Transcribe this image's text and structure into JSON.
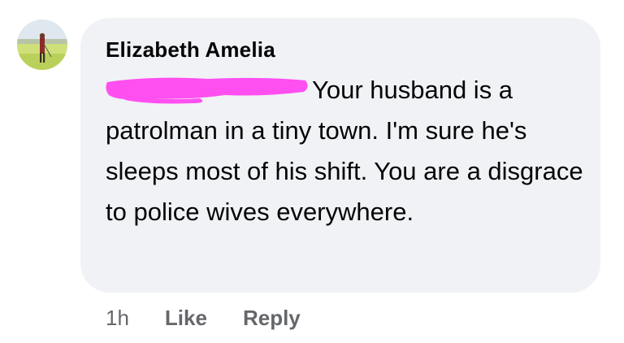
{
  "comment": {
    "author": "Elizabeth Amelia",
    "avatar_icon": "profile-photo-golfer",
    "redaction_color": "#ff4ff0",
    "text": "Your husband is a patrolman in a tiny town. I'm sure he's sleeps most of his shift. You are a disgrace to police wives everywhere."
  },
  "actions": {
    "time": "1h",
    "like_label": "Like",
    "reply_label": "Reply"
  },
  "colors": {
    "bubble_bg": "#f0f2f5",
    "text": "#050505",
    "meta": "#65676b"
  }
}
